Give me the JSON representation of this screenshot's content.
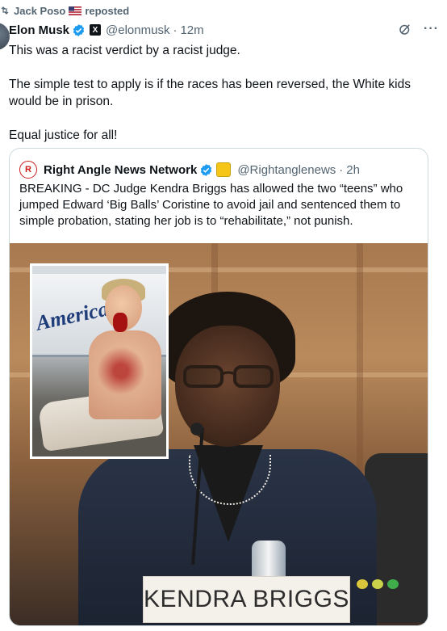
{
  "repost": {
    "user": "Jack Poso",
    "label": "reposted"
  },
  "post": {
    "author_name": "Elon Musk",
    "handle": "@elonmusk",
    "time": "12m",
    "text": {
      "line1": "This was a racist verdict by a racist judge.",
      "line2": "The simple test to apply is if the races has been reversed, the White kids would be in prison.",
      "line3": "Equal justice for all!"
    },
    "more": "···"
  },
  "quote": {
    "logo_text": "R",
    "author_name": "Right Angle News Network",
    "handle": "@Rightanglenews",
    "time": "2h",
    "text": "BREAKING - DC Judge Kendra Briggs has allowed the two “teens” who jumped Edward ‘Big Balls’ Coristine to avoid jail and sentenced them to simple probation, stating her job is to “rehabilitate,” not punish.",
    "image": {
      "inset_van_text": "American",
      "nameplate": "KENDRA BRIGGS"
    }
  },
  "colors": {
    "verified_blue": "#1d9bf0",
    "gold_badge": "#f5c518",
    "secondary_text": "#536471"
  },
  "icons": [
    "repost-icon",
    "us-flag-icon",
    "verified-badge-icon",
    "x-logo-icon",
    "grok-icon",
    "more-icon",
    "gold-badge-icon"
  ]
}
